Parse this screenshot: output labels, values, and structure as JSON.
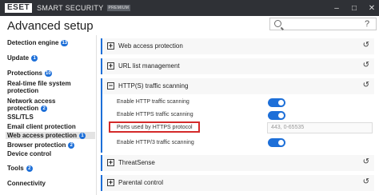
{
  "titlebar": {
    "logo": "ESET",
    "product": "SMART SECURITY",
    "edition": "PREMIUM",
    "controls": [
      "–",
      "□",
      "✕"
    ]
  },
  "header": {
    "title": "Advanced setup",
    "search_placeholder": "",
    "help": "?"
  },
  "sidebar": {
    "items": [
      {
        "label": "Detection engine",
        "badge": "13"
      },
      {
        "label": "Update",
        "badge": "1"
      },
      {
        "label": "Protections",
        "badge": "10"
      },
      {
        "label": "Real-time file system protection",
        "badge": ""
      },
      {
        "label": "Network access protection",
        "badge": "2"
      },
      {
        "label": "SSL/TLS",
        "badge": ""
      },
      {
        "label": "Email client protection",
        "badge": ""
      },
      {
        "label": "Web access protection",
        "badge": "1"
      },
      {
        "label": "Browser protection",
        "badge": "2"
      },
      {
        "label": "Device control",
        "badge": ""
      },
      {
        "label": "Tools",
        "badge": "2"
      },
      {
        "label": "Connectivity",
        "badge": ""
      }
    ]
  },
  "main": {
    "sections": [
      {
        "title": "Web access protection",
        "expanded": false,
        "icon": "+"
      },
      {
        "title": "URL list management",
        "expanded": false,
        "icon": "+"
      },
      {
        "title": "HTTP(S) traffic scanning",
        "expanded": true,
        "icon": "−"
      },
      {
        "title": "ThreatSense",
        "expanded": false,
        "icon": "+"
      },
      {
        "title": "Parental control",
        "expanded": false,
        "icon": "+"
      }
    ],
    "rows": [
      {
        "label": "Enable HTTP traffic scanning",
        "type": "toggle",
        "on": true
      },
      {
        "label": "Enable HTTPS traffic scanning",
        "type": "toggle",
        "on": true
      },
      {
        "label": "Ports used by HTTPS protocol",
        "type": "text",
        "value": "443, 0-65535"
      },
      {
        "label": "Enable HTTP/3 traffic scanning",
        "type": "toggle",
        "on": true
      }
    ],
    "reset_icon": "↺"
  },
  "colors": {
    "accent": "#1d6fd8",
    "titlebar": "#2f3136",
    "highlight": "#d42a2a"
  }
}
